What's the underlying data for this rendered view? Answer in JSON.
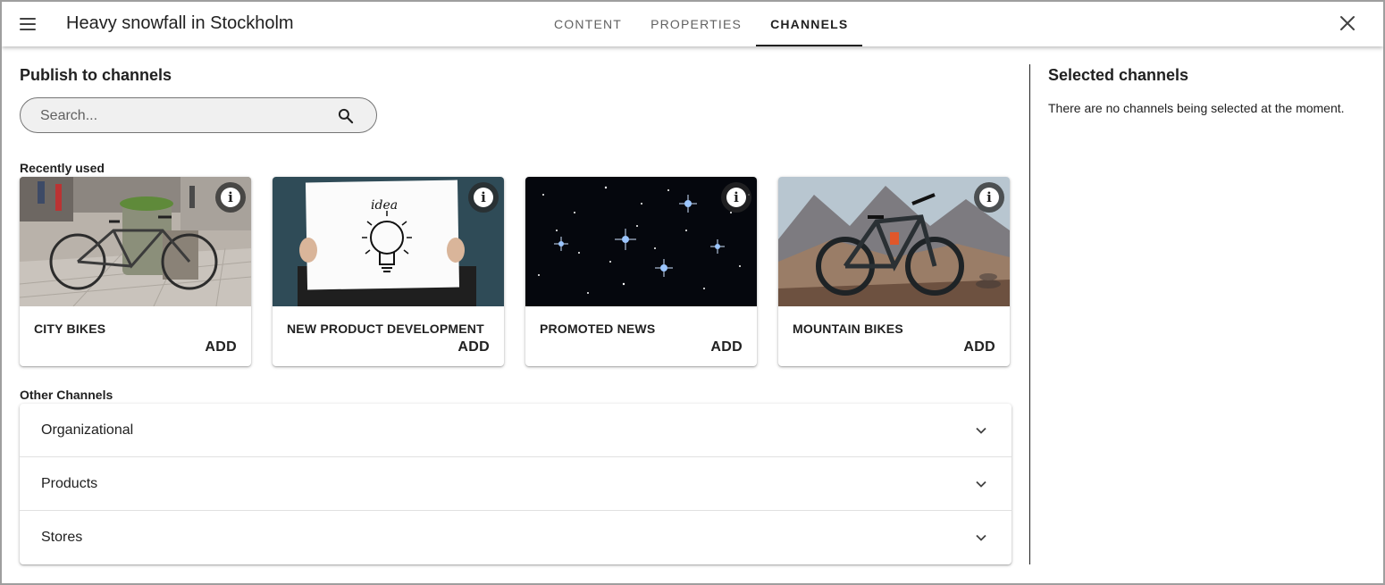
{
  "header": {
    "title": "Heavy snowfall in Stockholm",
    "tabs": [
      {
        "label": "CONTENT",
        "active": false
      },
      {
        "label": "PROPERTIES",
        "active": false
      },
      {
        "label": "CHANNELS",
        "active": true
      }
    ]
  },
  "publish": {
    "title": "Publish to channels",
    "search": {
      "placeholder": "Search...",
      "value": ""
    },
    "recently_used_label": "Recently used",
    "cards": [
      {
        "title": "CITY BIKES",
        "add_label": "ADD",
        "image": "city-bike-photo"
      },
      {
        "title": "NEW PRODUCT DEVELOPMENT",
        "add_label": "ADD",
        "image": "idea-lightbulb-photo"
      },
      {
        "title": "PROMOTED NEWS",
        "add_label": "ADD",
        "image": "starfield-photo"
      },
      {
        "title": "MOUNTAIN BIKES",
        "add_label": "ADD",
        "image": "mountain-bike-photo"
      }
    ],
    "other_channels_label": "Other Channels",
    "other_channels": [
      {
        "label": "Organizational"
      },
      {
        "label": "Products"
      },
      {
        "label": "Stores"
      }
    ]
  },
  "selected": {
    "title": "Selected channels",
    "empty_message": "There are no channels being selected at the moment."
  },
  "colors": {
    "text": "#212121",
    "muted": "#616161",
    "search_bg": "#f0f0f0",
    "frame_border": "#9e9e9e"
  }
}
